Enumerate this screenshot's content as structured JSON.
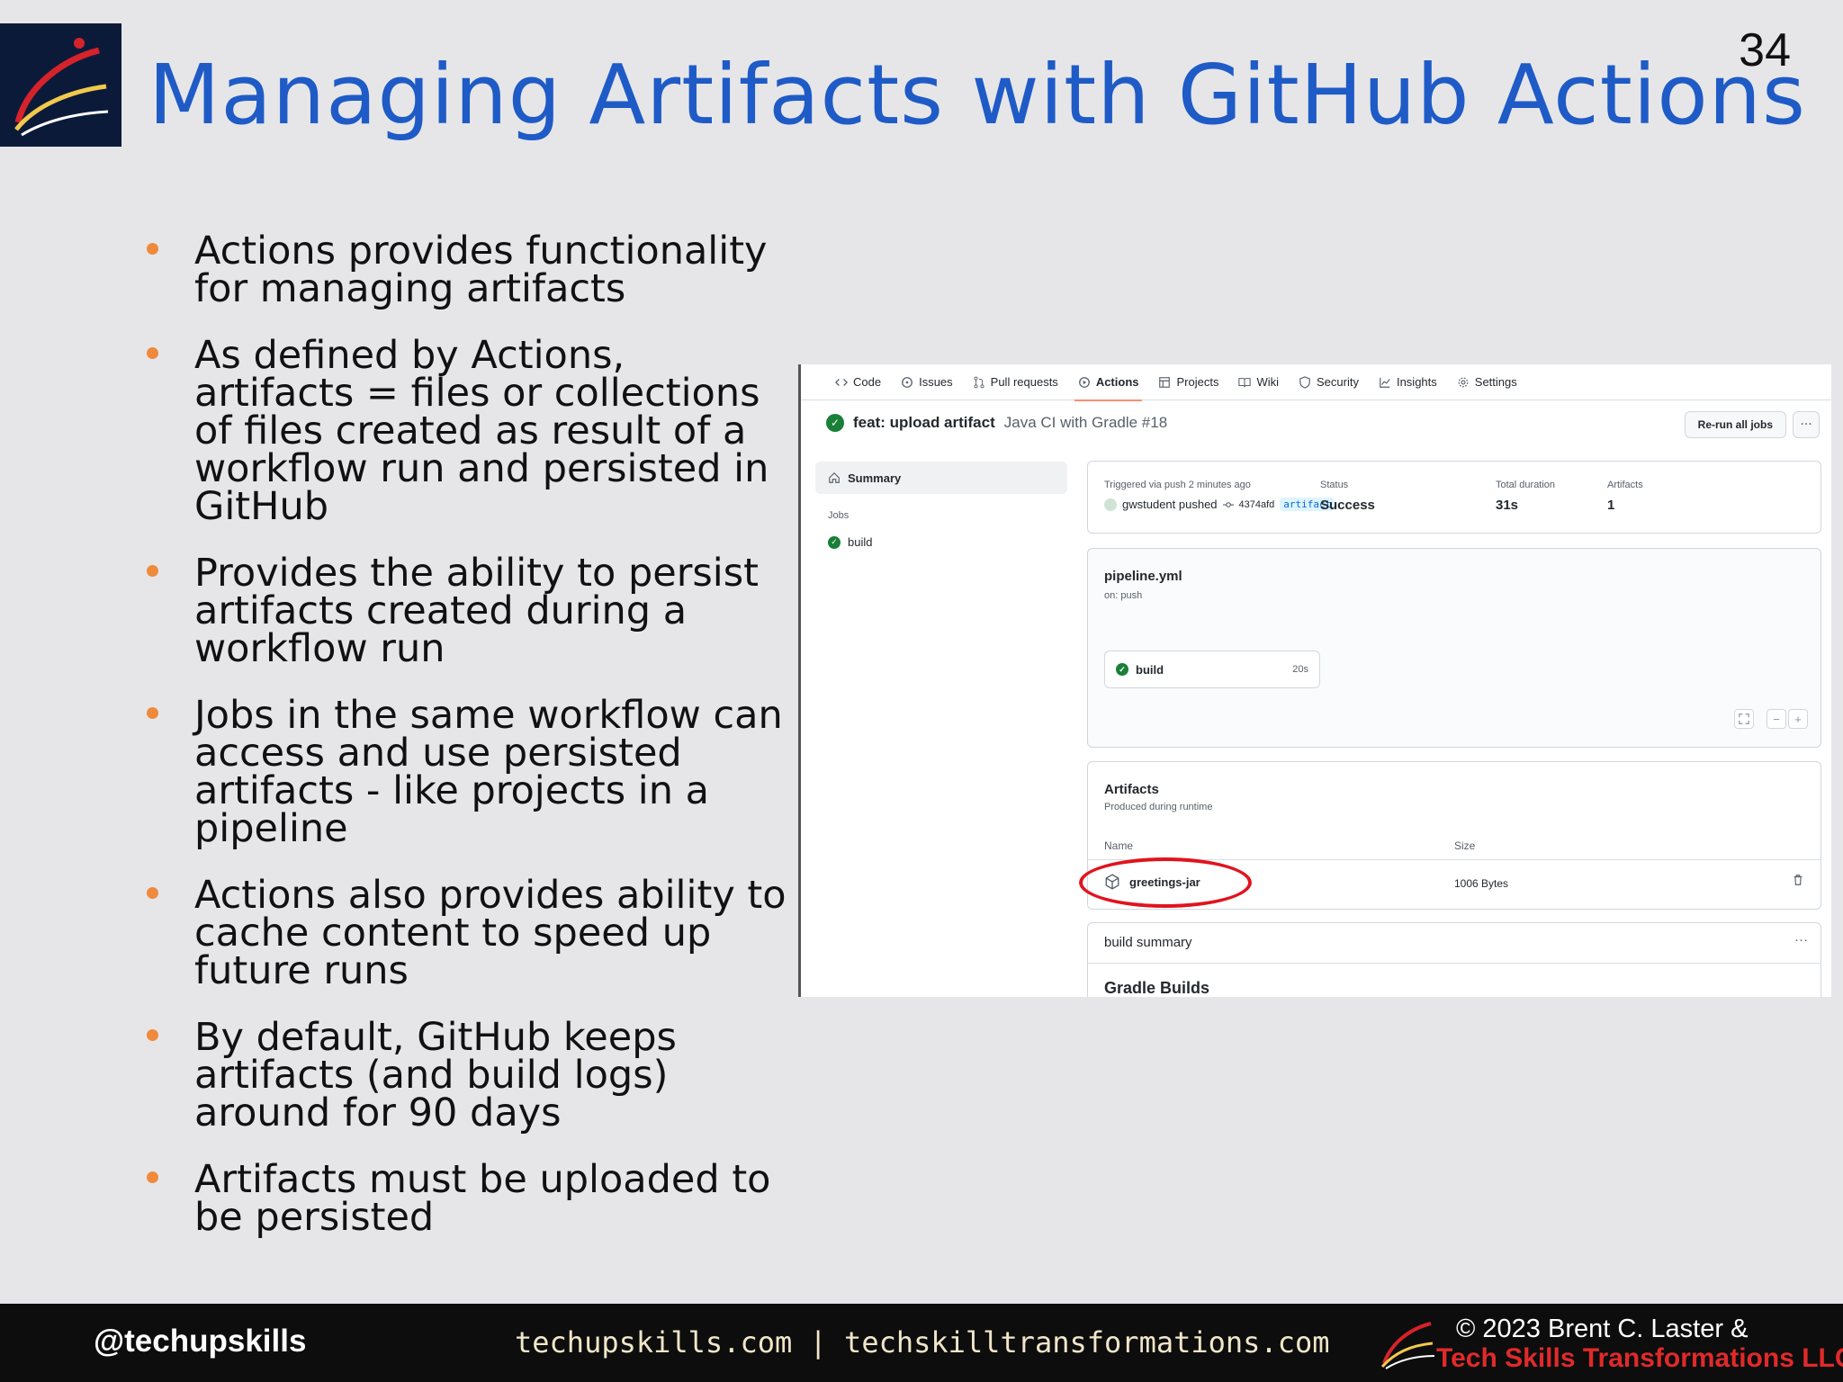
{
  "slide": {
    "title": "Managing Artifacts with GitHub Actions",
    "number": "34",
    "bullets": [
      "Actions provides functionality for managing artifacts",
      "As defined by Actions, artifacts = files or collections of files created as result of a workflow run and persisted in GitHub",
      "Provides the ability to persist artifacts created during a workflow run",
      "Jobs in the same workflow can access and use persisted artifacts - like projects in a pipeline",
      "Actions also provides ability to cache content to speed up future runs",
      "By default, GitHub keeps artifacts (and build logs) around for 90 days",
      "Artifacts must be uploaded to be persisted"
    ],
    "accent_color": "#1f5bc6",
    "bullet_color": "#ef8a3c"
  },
  "screenshot": {
    "nav": [
      {
        "label": "Code",
        "icon": "code-icon"
      },
      {
        "label": "Issues",
        "icon": "issue-icon"
      },
      {
        "label": "Pull requests",
        "icon": "pull-request-icon"
      },
      {
        "label": "Actions",
        "icon": "play-icon",
        "active": true
      },
      {
        "label": "Projects",
        "icon": "table-icon"
      },
      {
        "label": "Wiki",
        "icon": "book-icon"
      },
      {
        "label": "Security",
        "icon": "shield-icon"
      },
      {
        "label": "Insights",
        "icon": "graph-icon"
      },
      {
        "label": "Settings",
        "icon": "gear-icon"
      }
    ],
    "run": {
      "commit": "feat: upload artifact",
      "workflow": "Java CI with Gradle #18",
      "rerun_label": "Re-run all jobs",
      "more_label": "···"
    },
    "sidebar": {
      "summary": "Summary",
      "jobs_heading": "Jobs",
      "job": "build"
    },
    "summary_card": {
      "trigger_label": "Triggered via push 2 minutes ago",
      "pusher": "gwstudent pushed",
      "commit_sha": "4374afd",
      "branch": "artifact",
      "status_label": "Status",
      "status_value": "Success",
      "duration_label": "Total duration",
      "duration_value": "31s",
      "artifacts_label": "Artifacts",
      "artifacts_value": "1"
    },
    "workflow_card": {
      "file": "pipeline.yml",
      "trigger": "on: push",
      "job": "build",
      "job_duration": "20s",
      "zoom_minus": "−",
      "zoom_plus": "+"
    },
    "artifacts_card": {
      "title": "Artifacts",
      "subtitle": "Produced during runtime",
      "col_name": "Name",
      "col_size": "Size",
      "artifact_name": "greetings-jar",
      "artifact_size": "1006 Bytes"
    },
    "build_summary": {
      "title": "build summary",
      "dots": "···",
      "heading": "Gradle Builds"
    }
  },
  "footer": {
    "handle": "@techupskills",
    "sites": "techupskills.com | techskilltransformations.com",
    "copyright_line1": "© 2023 Brent C. Laster &",
    "copyright_line2": "Tech Skills Transformations LLC"
  }
}
